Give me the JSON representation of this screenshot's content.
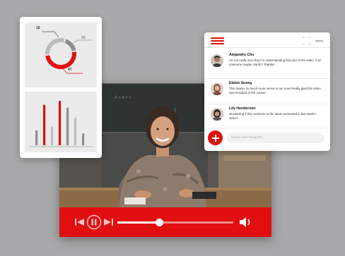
{
  "colors": {
    "accent": "#e10f0f",
    "background": "#a9a9ab",
    "panel": "#ebebeb",
    "bar_gray": "#8e8e8e"
  },
  "analytics": {
    "donut": {
      "labels": [
        "16",
        "29",
        "47"
      ],
      "segments": [
        {
          "value": 16,
          "color": "#8e8e8e"
        },
        {
          "value": 47,
          "color": "#e10f0f"
        },
        {
          "value": 29,
          "color": "#bdbdbd"
        }
      ]
    },
    "bars": {
      "values": [
        30,
        82,
        38,
        90,
        76,
        56,
        24
      ],
      "colors": [
        "#8e8e8e",
        "#e10f0f",
        "#bdbdbd",
        "#e10f0f",
        "#8e8e8e",
        "#bdbdbd",
        "#8e8e8e"
      ],
      "max": 100
    }
  },
  "chat": {
    "icons": {
      "menu": "hamburger-menu-icon",
      "expand": "expand-icon",
      "minimize": "minimize-icon",
      "add": "plus-icon"
    },
    "messages": [
      {
        "name": "Alejandro Cho",
        "text": "I'm not really sure that I'm understanding this part of the video. Can someone maybe clarify? Thanks!"
      },
      {
        "name": "Elaine Suveg",
        "text": "This makes so much more sense to me now! Really glad this video was included in the course."
      },
      {
        "name": "Lily Henderson",
        "text": "Wondering if this connects to the ideas presented in last week's video?"
      }
    ],
    "input_placeholder": "Share your thoughts..."
  },
  "player": {
    "progress": 0.36,
    "icons": {
      "prev": "skip-back-icon",
      "pause": "pause-icon",
      "next": "skip-forward-icon",
      "volume": "volume-icon"
    }
  }
}
